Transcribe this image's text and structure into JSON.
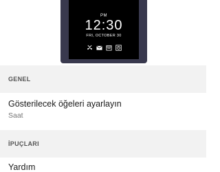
{
  "preview": {
    "ampm": "PM",
    "time": "12:30",
    "date": "FRI, OCTOBER 30",
    "status_icons": [
      "missed-call-icon",
      "email-icon",
      "calendar-icon",
      "alarm-icon"
    ]
  },
  "sections": {
    "general": {
      "header": "GENEL",
      "item": {
        "title": "Gösterilecek öğeleri ayarlayın",
        "subtitle": "Saat"
      }
    },
    "tips": {
      "header": "İPUÇLARI",
      "item": {
        "title": "Yardım"
      }
    }
  },
  "colors": {
    "device_frame": "#39394e",
    "screen": "#000000",
    "section_bg": "#f2f2f2"
  }
}
